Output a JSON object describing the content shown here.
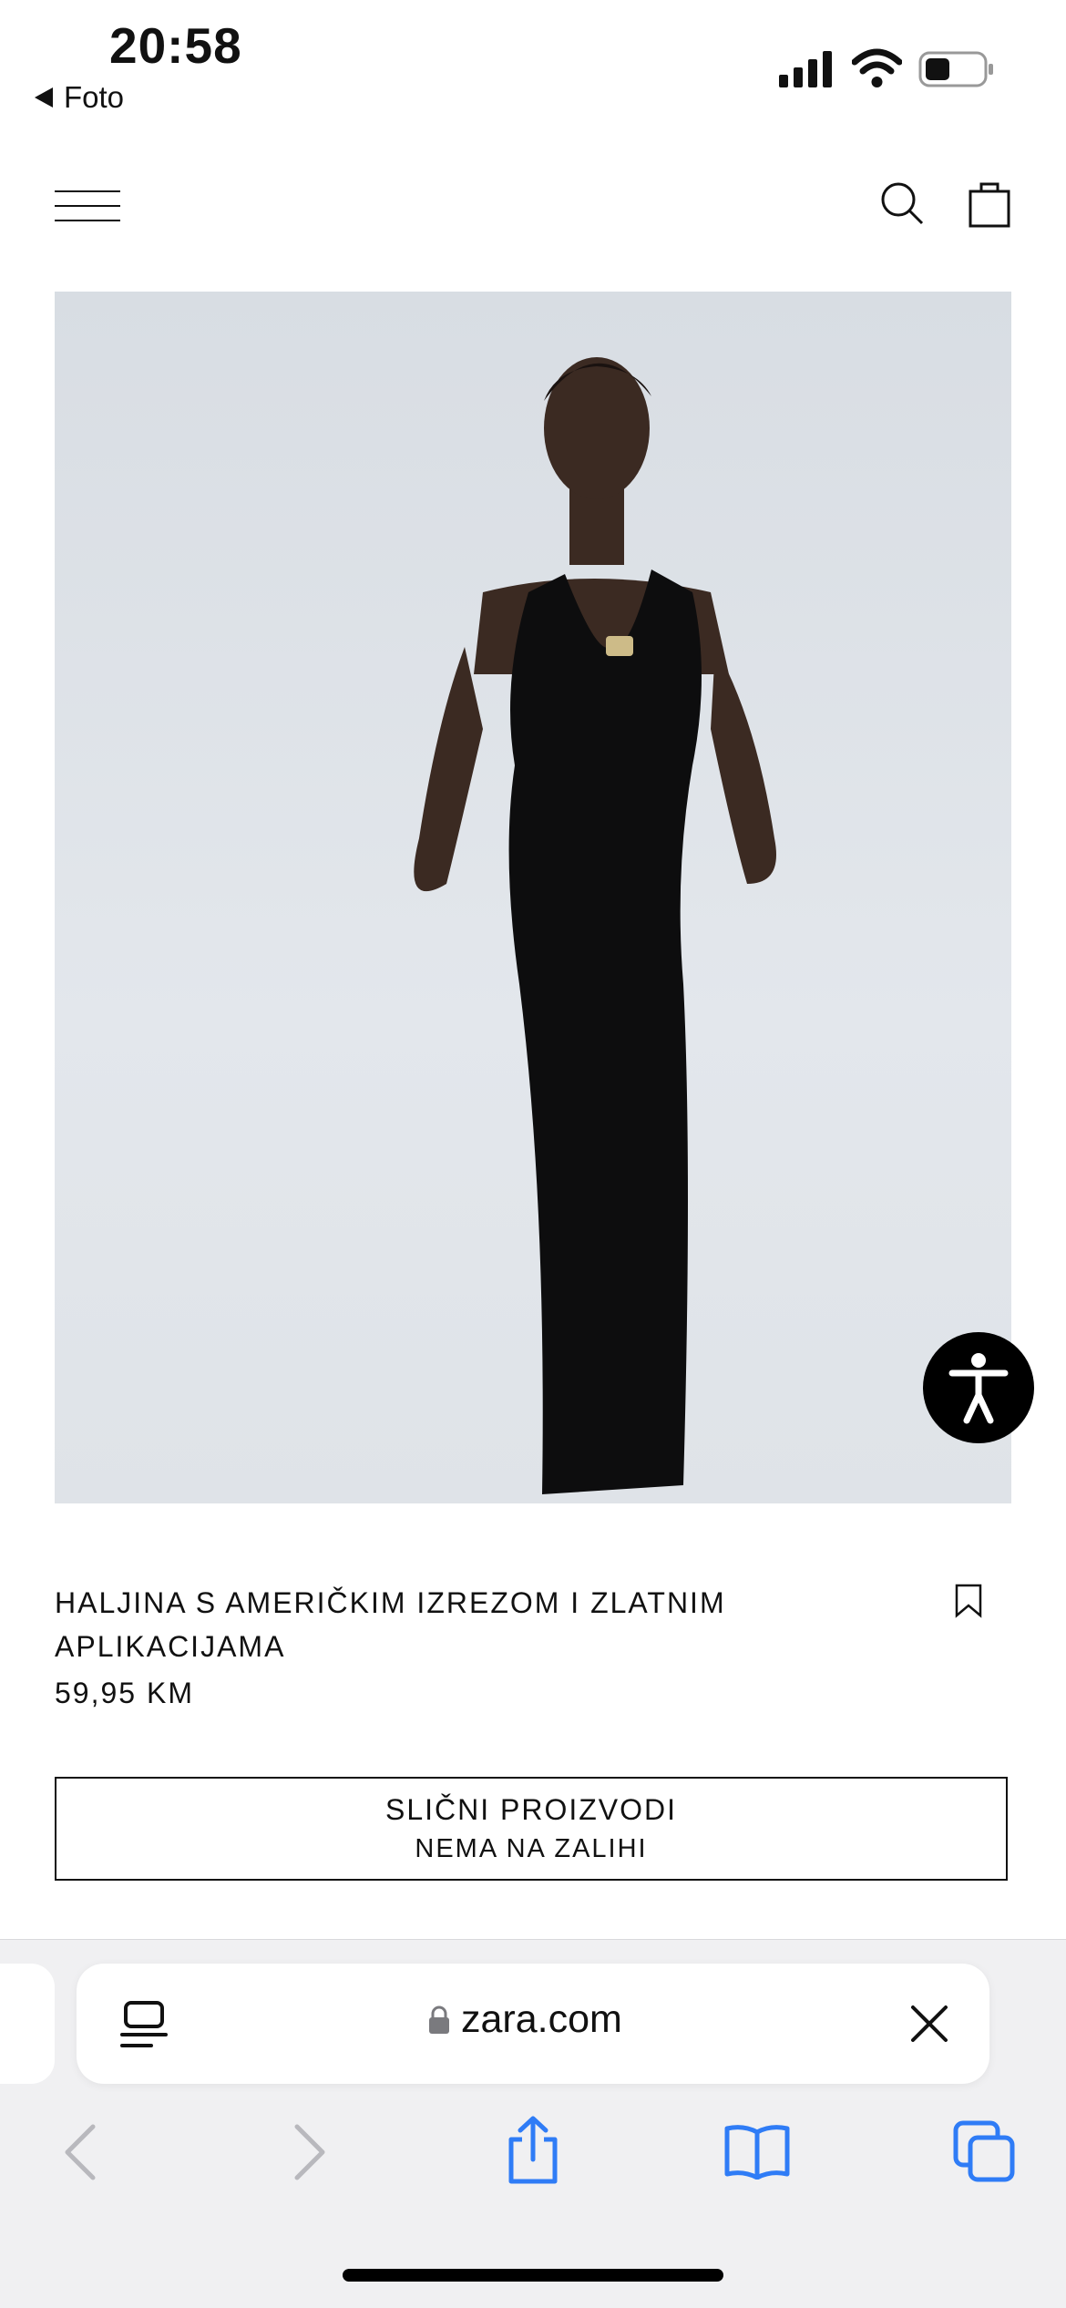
{
  "status_bar": {
    "time": "20:58",
    "back_app_label": "Foto",
    "icons": [
      "signal-icon",
      "wifi-icon",
      "battery-icon"
    ]
  },
  "header": {
    "icons": [
      "menu-icon",
      "search-icon",
      "shopping-bag-icon"
    ]
  },
  "product": {
    "image_alt": "model-in-black-halter-dress",
    "title": "HALJINA S AMERIČKIM IZREZOM I ZLATNIM APLIKACIJAMA",
    "price": "59,95 KM",
    "similar_button": {
      "line1": "SLIČNI PROIZVODI",
      "line2": "NEMA NA ZALIHI"
    }
  },
  "browser": {
    "url": "zara.com",
    "toolbar_icons": [
      "back-icon",
      "forward-icon",
      "share-icon",
      "bookmarks-icon",
      "tabs-icon"
    ]
  },
  "colors": {
    "accent": "#2f7cf6",
    "disabled": "#b8b8bd",
    "text": "#111111"
  }
}
